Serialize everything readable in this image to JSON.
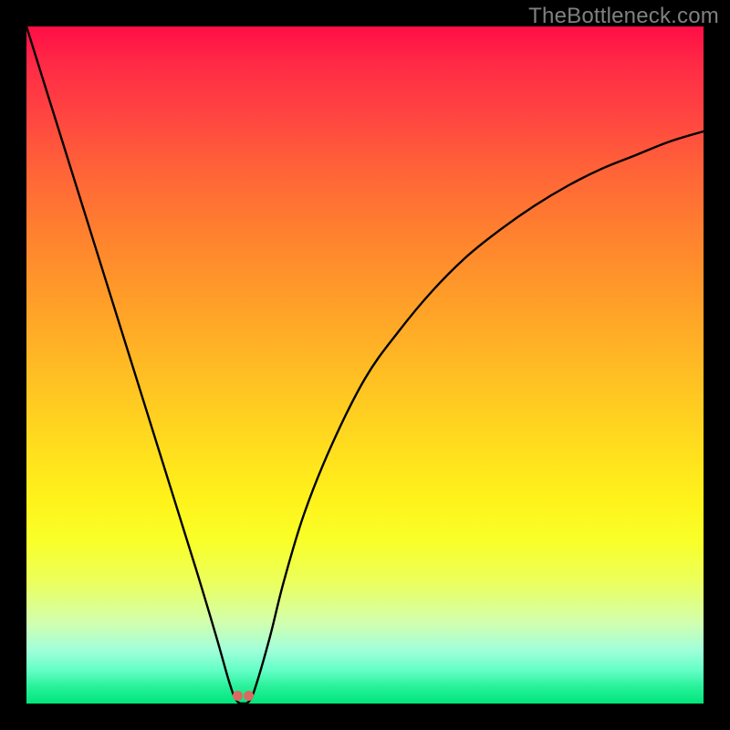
{
  "watermark": "TheBottleneck.com",
  "chart_data": {
    "type": "line",
    "title": "",
    "xlabel": "",
    "ylabel": "",
    "xlim": [
      0,
      100
    ],
    "ylim": [
      0,
      100
    ],
    "grid": false,
    "legend": false,
    "series": [
      {
        "name": "bottleneck-curve",
        "x": [
          0,
          5,
          10,
          15,
          20,
          25,
          28,
          30,
          31,
          32,
          33,
          34,
          36,
          38,
          41,
          45,
          50,
          55,
          60,
          65,
          70,
          75,
          80,
          85,
          90,
          95,
          100
        ],
        "values": [
          100,
          84,
          68,
          52,
          36,
          20,
          10,
          3,
          0.5,
          0,
          0.5,
          3,
          10,
          18,
          28,
          38,
          48,
          55,
          61,
          66,
          70,
          73.5,
          76.5,
          79,
          81,
          83,
          84.5
        ]
      }
    ],
    "markers": [
      {
        "name": "indicator-dot",
        "x": 31.3,
        "y": 0,
        "color": "#d86b61"
      },
      {
        "name": "indicator-dot",
        "x": 32.9,
        "y": 0,
        "color": "#d86b61"
      }
    ],
    "background_gradient": {
      "direction": "vertical",
      "stops": [
        {
          "pos": 0,
          "color": "#ff0e46"
        },
        {
          "pos": 50,
          "color": "#ffc622"
        },
        {
          "pos": 75,
          "color": "#f9ff29"
        },
        {
          "pos": 100,
          "color": "#00e67b"
        }
      ]
    }
  },
  "colors": {
    "frame_bg": "#000000",
    "curve": "#000000",
    "marker": "#d86b61",
    "watermark": "#808080"
  }
}
